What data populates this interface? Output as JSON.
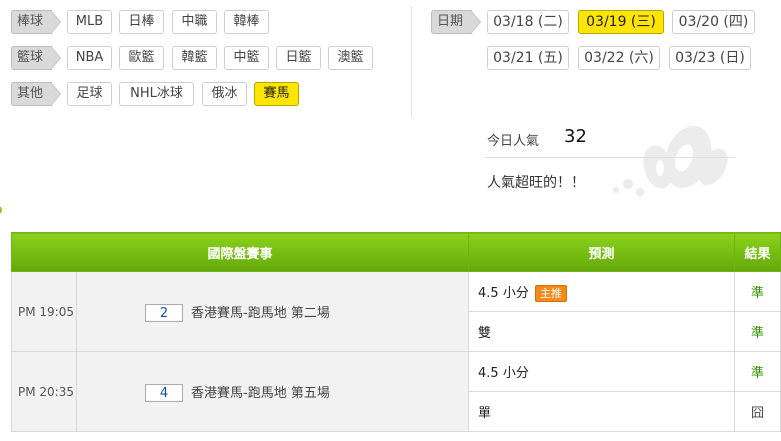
{
  "filters": {
    "baseball": {
      "label": "棒球",
      "items": [
        "MLB",
        "日棒",
        "中職",
        "韓棒"
      ]
    },
    "basketball": {
      "label": "籃球",
      "items": [
        "NBA",
        "歐籃",
        "韓籃",
        "中籃",
        "日籃",
        "澳籃"
      ]
    },
    "other": {
      "label": "其他",
      "items": [
        "足球",
        "NHL冰球",
        "俄冰",
        "賽馬"
      ],
      "active": "賽馬"
    }
  },
  "dates": {
    "label": "日期",
    "items": [
      "03/18 (二)",
      "03/19 (三)",
      "03/20 (四)",
      "03/21 (五)",
      "03/22 (六)",
      "03/23 (日)"
    ],
    "active": "03/19 (三)"
  },
  "popularity": {
    "label": "今日人氣",
    "value": "32",
    "message": "人氣超旺的！！"
  },
  "table": {
    "headers": {
      "event": "國際盤賽事",
      "prediction": "預測",
      "result": "結果"
    },
    "matches": [
      {
        "time": "PM 19:05",
        "number": "2",
        "name": "香港賽馬-跑馬地 第二場",
        "picks": [
          {
            "text": "4.5 小分",
            "badge": "主推",
            "result": "準"
          },
          {
            "text": "雙",
            "badge": "",
            "result": "準"
          }
        ]
      },
      {
        "time": "PM 20:35",
        "number": "4",
        "name": "香港賽馬-跑馬地 第五場",
        "picks": [
          {
            "text": "4.5 小分",
            "badge": "",
            "result": "準"
          },
          {
            "text": "單",
            "badge": "",
            "result": "囧"
          }
        ]
      }
    ]
  },
  "colors": {
    "accent": "#ffe500",
    "header_green": "#74bd12",
    "win_green": "#2f8f00",
    "badge_orange": "#f28a1c"
  }
}
